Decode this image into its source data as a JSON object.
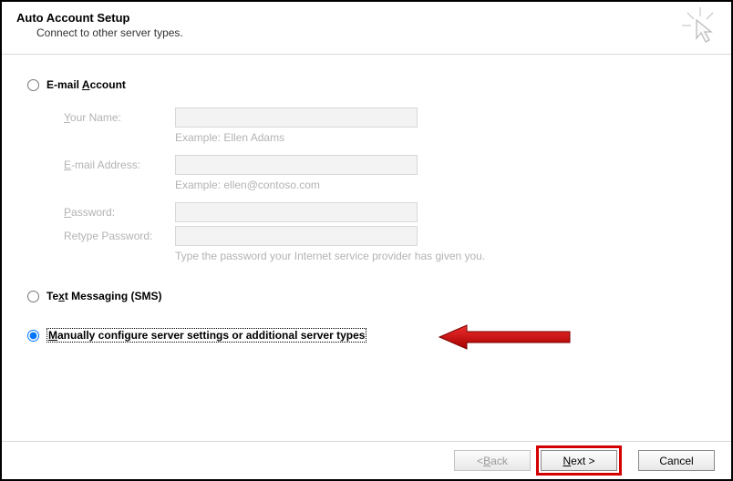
{
  "header": {
    "title": "Auto Account Setup",
    "subtitle": "Connect to other server types."
  },
  "options": {
    "email_label_pre": "E-mail ",
    "email_label_key": "A",
    "email_label_post": "ccount",
    "sms_label_pre": "Te",
    "sms_label_key": "x",
    "sms_label_post": "t Messaging (SMS)",
    "manual_label_pre": "",
    "manual_label_key": "M",
    "manual_label_post": "anually configure server settings or additional server types"
  },
  "form": {
    "your_name_pre": "",
    "your_name_key": "Y",
    "your_name_post": "our Name:",
    "your_name_hint": "Example: Ellen Adams",
    "email_pre": "",
    "email_key": "E",
    "email_post": "-mail Address:",
    "email_hint": "Example: ellen@contoso.com",
    "password_pre": "",
    "password_key": "P",
    "password_post": "assword:",
    "retype_label": "Retype Password:",
    "password_hint": "Type the password your Internet service provider has given you."
  },
  "footer": {
    "back_pre": "< ",
    "back_key": "B",
    "back_post": "ack",
    "next_pre": "",
    "next_key": "N",
    "next_post": "ext >",
    "cancel": "Cancel"
  }
}
